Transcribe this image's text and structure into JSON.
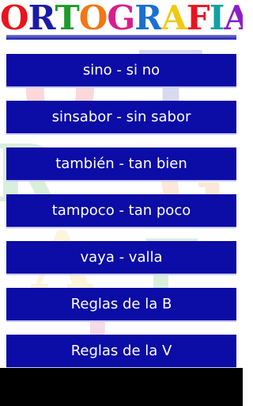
{
  "header": {
    "logo_letters": [
      {
        "char": "O",
        "color": "#e8141e"
      },
      {
        "char": "R",
        "color": "#1a1aa8"
      },
      {
        "char": "T",
        "color": "#1e9b2a"
      },
      {
        "char": "O",
        "color": "#f07814"
      },
      {
        "char": "G",
        "color": "#d81e8c"
      },
      {
        "char": "R",
        "color": "#1a6fd0"
      },
      {
        "char": "A",
        "color": "#f0c814"
      },
      {
        "char": "F",
        "color": "#e8141e"
      },
      {
        "char": "I",
        "color": "#14a0a0"
      },
      {
        "char": "A",
        "color": "#8c1ec8"
      }
    ]
  },
  "menu": {
    "items": [
      {
        "label": "sino - si no"
      },
      {
        "label": "sinsabor - sin sabor"
      },
      {
        "label": "también - tan bien"
      },
      {
        "label": "tampoco - tan poco"
      },
      {
        "label": "vaya - valla"
      },
      {
        "label": "Reglas de la B"
      },
      {
        "label": "Reglas de la V"
      }
    ]
  },
  "colors": {
    "item_background": "#0c0ca6",
    "item_text": "#ffffff",
    "header_rule": "#1c1ca8",
    "bottom_bar": "#000000"
  }
}
